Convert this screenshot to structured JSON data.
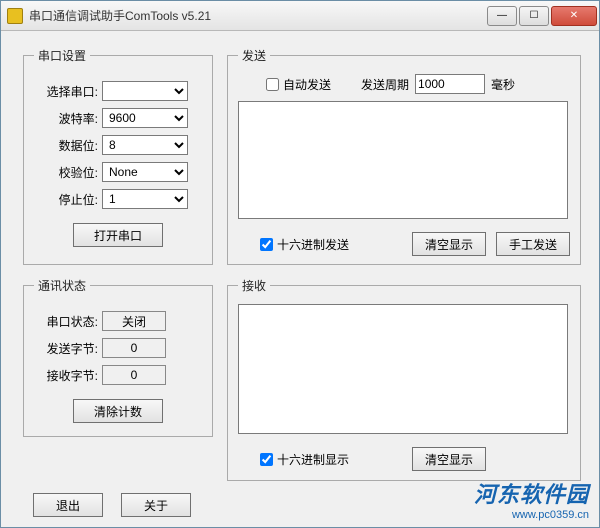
{
  "title": "串口通信调试助手ComTools v5.21",
  "win": {
    "min": "—",
    "max": "☐",
    "close": "✕"
  },
  "port": {
    "legend": "串口设置",
    "select_label": "选择串口:",
    "select_value": "",
    "baud_label": "波特率:",
    "baud_value": "9600",
    "data_label": "数据位:",
    "data_value": "8",
    "parity_label": "校验位:",
    "parity_value": "None",
    "stop_label": "停止位:",
    "stop_value": "1",
    "open_btn": "打开串口"
  },
  "status": {
    "legend": "通讯状态",
    "port_state_label": "串口状态:",
    "port_state_value": "关闭",
    "tx_label": "发送字节:",
    "tx_value": "0",
    "rx_label": "接收字节:",
    "rx_value": "0",
    "clear_btn": "清除计数"
  },
  "send": {
    "legend": "发送",
    "auto_label": "自动发送",
    "period_label": "发送周期",
    "period_value": "1000",
    "period_unit": "毫秒",
    "text": "",
    "hex_label": "十六进制发送",
    "clear_btn": "清空显示",
    "manual_btn": "手工发送"
  },
  "recv": {
    "legend": "接收",
    "text": "",
    "hex_label": "十六进制显示",
    "clear_btn": "清空显示"
  },
  "footer": {
    "exit": "退出",
    "about": "关于"
  },
  "watermark": {
    "brand": "河东软件园",
    "url": "www.pc0359.cn"
  }
}
